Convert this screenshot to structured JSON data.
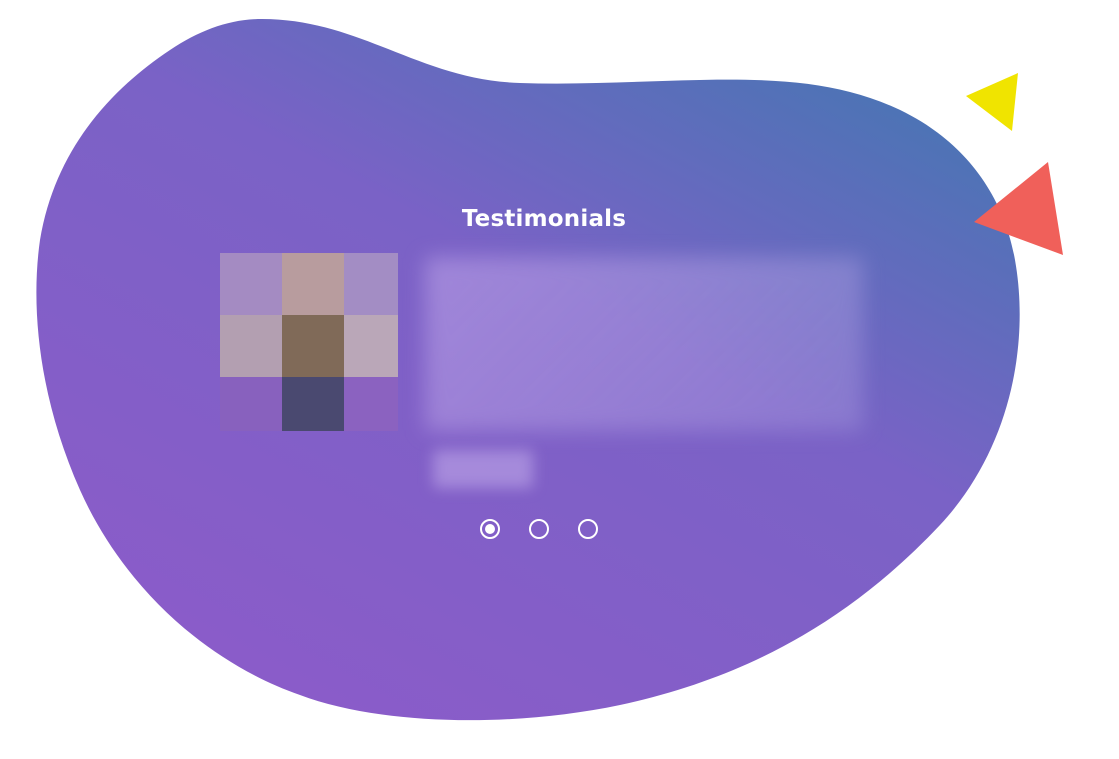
{
  "section": {
    "title": "Testimonials"
  },
  "colors": {
    "blob_gradient_start": "#4477b2",
    "blob_gradient_mid": "#7a62c6",
    "blob_gradient_end": "#8a5cc9",
    "accent_yellow": "#f0e400",
    "accent_red": "#f0605a"
  },
  "avatar_pixels": [
    "#a48bc2",
    "#b89c9e",
    "#a38dc4",
    "#b39fb1",
    "#806a58",
    "#baa7b8",
    "#8861be",
    "#4a4970",
    "#8b62c0"
  ],
  "carousel": {
    "slide_count": 3,
    "active_index": 0
  },
  "icons": {
    "yellow_triangle": "triangle-decoration-icon",
    "red_triangle": "triangle-decoration-icon",
    "dot": "carousel-dot-icon"
  }
}
